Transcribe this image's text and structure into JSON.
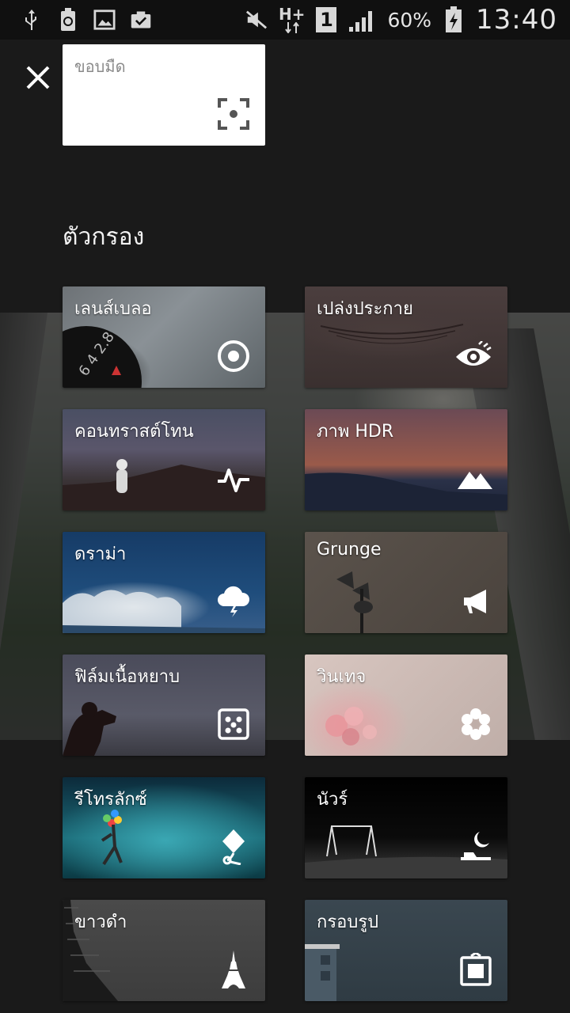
{
  "status_bar": {
    "battery_percent": "60%",
    "time": "13:40",
    "network_type": "H+",
    "sim_slot": "1"
  },
  "search": {
    "label": "ขอบมืด"
  },
  "section_title": "ตัวกรอง",
  "filters": [
    {
      "label": "เลนส์เบลอ",
      "icon": "target-icon"
    },
    {
      "label": "เปล่งประกาย",
      "icon": "eye-icon"
    },
    {
      "label": "คอนทราสต์โทน",
      "icon": "pulse-icon"
    },
    {
      "label": "ภาพ HDR",
      "icon": "mountains-icon"
    },
    {
      "label": "ดราม่า",
      "icon": "storm-cloud-icon"
    },
    {
      "label": "Grunge",
      "icon": "megaphone-icon"
    },
    {
      "label": "ฟิล์มเนื้อหยาบ",
      "icon": "dice-icon"
    },
    {
      "label": "วินเทจ",
      "icon": "flower-icon"
    },
    {
      "label": "รีโทรลักซ์",
      "icon": "kite-icon"
    },
    {
      "label": "นัวร์",
      "icon": "moon-icon"
    },
    {
      "label": "ขาวดำ",
      "icon": "eiffel-tower-icon"
    },
    {
      "label": "กรอบรูป",
      "icon": "frame-icon"
    }
  ]
}
